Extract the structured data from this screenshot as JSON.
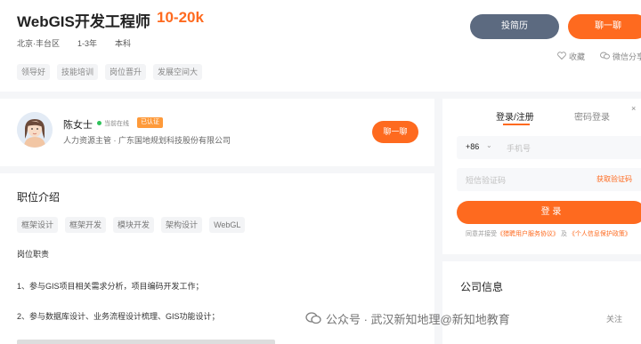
{
  "job": {
    "title": "WebGIS开发工程师",
    "salary": "10-20k",
    "location": "北京·丰台区",
    "experience": "1-3年",
    "education": "本科",
    "benefits": [
      "领导好",
      "技能培训",
      "岗位晋升",
      "发展空间大"
    ]
  },
  "actions": {
    "apply_label": "投简历",
    "chat_label": "聊一聊",
    "collect_label": "收藏",
    "share_label": "微信分享"
  },
  "hr": {
    "name": "陈女士",
    "status": "当前在线",
    "badge": "已认证",
    "subtitle": "人力资源主管 · 广东国地规划科技股份有限公司",
    "chat_label": "聊一聊"
  },
  "description": {
    "section_title": "职位介绍",
    "skills": [
      "框架设计",
      "框架开发",
      "模块开发",
      "架构设计",
      "WebGL"
    ],
    "duty_label": "岗位职责",
    "duties": [
      "1、参与GIS项目相关需求分析，项目编码开发工作；",
      "2、参与数据库设计、业务流程设计梳理、GIS功能设计；"
    ]
  },
  "login": {
    "tab_active": "登录/注册",
    "tab_other": "密码登录",
    "close_glyph": "×",
    "country_code": "+86",
    "phone_placeholder": "手机号",
    "sms_placeholder": "短信验证码",
    "get_code": "获取验证码",
    "submit": "登 录",
    "agree_prefix": "同意并接受",
    "agree_link1": "《猎聘用户服务协议》",
    "agree_mid": "及",
    "agree_link2": "《个人信息保护政策》"
  },
  "company": {
    "section_title": "公司信息",
    "follow_label": "关注"
  },
  "watermark": {
    "text": "公众号 · 武汉新知地理@新知地教育"
  },
  "colors": {
    "accent": "#fe6a1f",
    "apply_button": "#5c6a80",
    "online": "#2fc25b"
  }
}
